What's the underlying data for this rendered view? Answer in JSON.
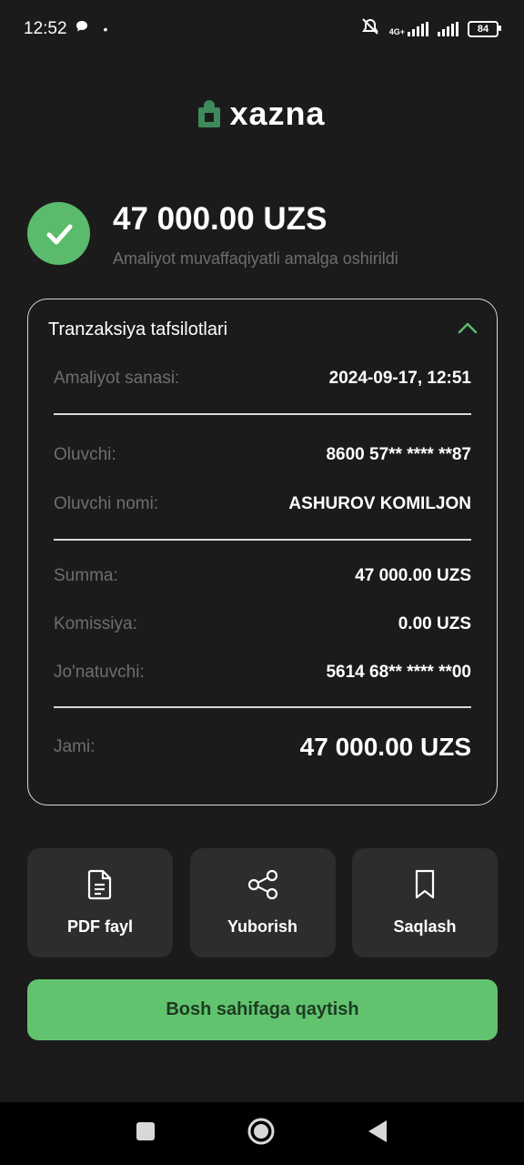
{
  "status_bar": {
    "time": "12:52",
    "network": "4G+",
    "battery": "84"
  },
  "brand": {
    "name": "xazna",
    "accent": "#3d8a5a"
  },
  "result": {
    "amount": "47 000.00 UZS",
    "message": "Amaliyot muvaffaqiyatli amalga oshirildi",
    "success_color": "#5bbb6c"
  },
  "details": {
    "title": "Tranzaksiya tafsilotlari",
    "date_label": "Amaliyot sanasi:",
    "date_value": "2024-09-17, 12:51",
    "recipient_label": "Oluvchi:",
    "recipient_value": "8600 57** **** **87",
    "recipient_name_label": "Oluvchi nomi:",
    "recipient_name_value": "ASHUROV KOMILJON",
    "sum_label": "Summa:",
    "sum_value": "47 000.00 UZS",
    "fee_label": "Komissiya:",
    "fee_value": "0.00 UZS",
    "sender_label": "Jo'natuvchi:",
    "sender_value": "5614 68** **** **00",
    "total_label": "Jami:",
    "total_value": "47 000.00 UZS"
  },
  "actions": [
    {
      "label": "PDF fayl",
      "icon": "document-icon"
    },
    {
      "label": "Yuborish",
      "icon": "share-icon"
    },
    {
      "label": "Saqlash",
      "icon": "bookmark-icon"
    }
  ],
  "home_button": {
    "label": "Bosh sahifaga qaytish",
    "color": "#62c36e"
  }
}
